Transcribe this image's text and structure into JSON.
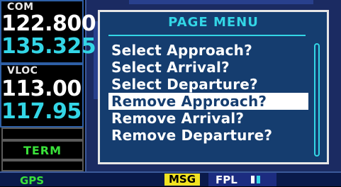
{
  "com": {
    "label": "COM",
    "active": "122.800",
    "standby": "135.325"
  },
  "vloc": {
    "label": "VLOC",
    "active": "113.00",
    "standby": "117.95"
  },
  "cdi": {
    "mode": "TERM"
  },
  "page_menu": {
    "title": "PAGE MENU",
    "items": [
      {
        "label": "Select Approach?"
      },
      {
        "label": "Select Arrival?"
      },
      {
        "label": "Select Departure?"
      },
      {
        "label": "Remove Approach?"
      },
      {
        "label": "Remove Arrival?"
      },
      {
        "label": "Remove Departure?"
      }
    ],
    "selected_index": 3
  },
  "status_bar": {
    "mode": "GPS",
    "msg": "MSG",
    "page_group": "FPL"
  },
  "colors": {
    "cyan": "#33d6e6",
    "green": "#3ae23a",
    "menu_bg": "#153d6f",
    "msg_yellow": "#f1e320"
  }
}
